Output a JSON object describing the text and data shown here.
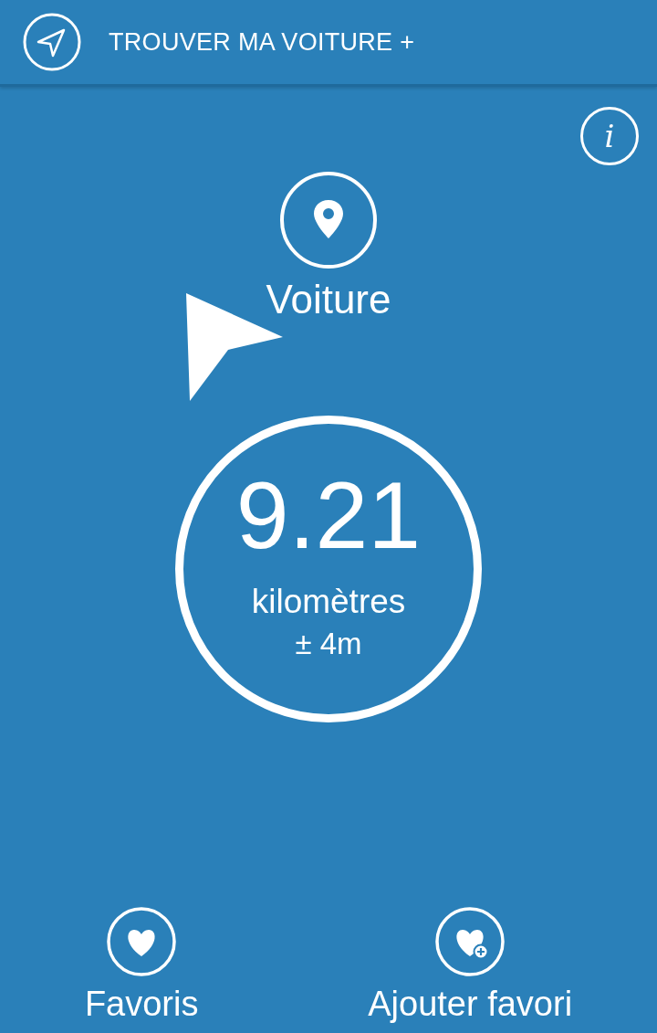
{
  "app_bar": {
    "title": "TROUVER MA VOITURE +"
  },
  "info_button": {
    "label": "i"
  },
  "destination": {
    "label": "Voiture"
  },
  "distance": {
    "value": "9.21",
    "unit": "kilomètres",
    "accuracy": "± 4m"
  },
  "bottom_actions": [
    {
      "kind": "favorites",
      "label": "Favoris"
    },
    {
      "kind": "add_favorite",
      "label": "Ajouter favori"
    }
  ]
}
